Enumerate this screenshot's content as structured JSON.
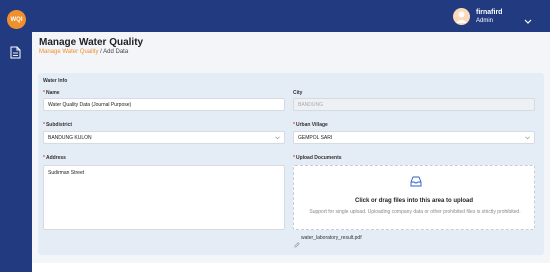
{
  "app": {
    "logo_text": "WQI"
  },
  "user": {
    "name": "firnafird",
    "role": "Admin"
  },
  "page": {
    "title": "Manage Water Quality",
    "breadcrumb": {
      "link": "Manage Water Quality",
      "separator": " / ",
      "current": "Add Data"
    }
  },
  "form": {
    "section_title": "Water Info",
    "name": {
      "label": "Name",
      "value": "Water Quality Data (Journal Purpose)"
    },
    "city": {
      "label": "City",
      "value": "BANDUNG"
    },
    "subdistrict": {
      "label": "Subdistrict",
      "value": "BANDUNG KULON"
    },
    "urban_village": {
      "label": "Urban Village",
      "value": "GEMPOL SARI"
    },
    "address": {
      "label": "Address",
      "value": "Sudirman Street"
    },
    "upload": {
      "label": "Upload Documents",
      "title": "Click or drag files into this area to upload",
      "hint": "Support for single upload. Uploading company data or other prohibited files is strictly prohibited.",
      "file_name": "water_laboratory_result.pdf"
    }
  },
  "colors": {
    "primary": "#223a80",
    "accent": "#f0902d",
    "required": "#e0453a"
  }
}
